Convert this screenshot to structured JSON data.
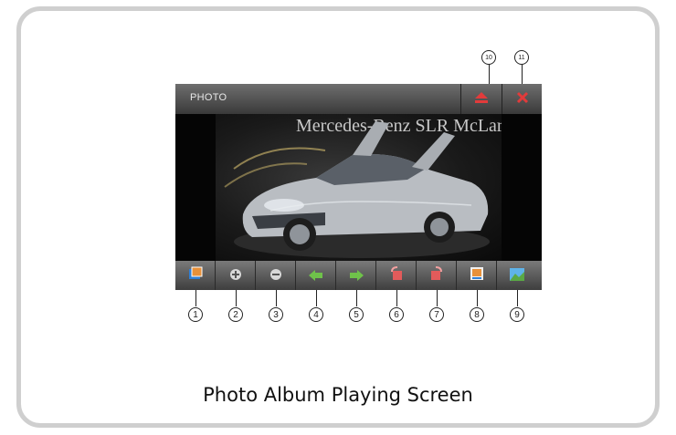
{
  "screen": {
    "title": "PHOTO",
    "photo_caption": "Mercedes-Benz SLR McLaren"
  },
  "toolbar_buttons": [
    {
      "name": "eject-button",
      "icon": "eject-icon",
      "color": "#e23b3b"
    },
    {
      "name": "close-button",
      "icon": "close-icon",
      "color": "#e23b3b"
    }
  ],
  "control_buttons": [
    {
      "name": "slideshow-button",
      "icon": "slideshow-icon"
    },
    {
      "name": "zoom-in-button",
      "icon": "zoom-in-icon"
    },
    {
      "name": "zoom-out-button",
      "icon": "zoom-out-icon"
    },
    {
      "name": "previous-button",
      "icon": "arrow-left-icon"
    },
    {
      "name": "next-button",
      "icon": "arrow-right-icon"
    },
    {
      "name": "rotate-left-button",
      "icon": "rotate-left-icon"
    },
    {
      "name": "rotate-right-button",
      "icon": "rotate-right-icon"
    },
    {
      "name": "info-button",
      "icon": "info-icon"
    },
    {
      "name": "thumbnail-button",
      "icon": "picture-icon"
    }
  ],
  "callouts": [
    "1",
    "2",
    "3",
    "4",
    "5",
    "6",
    "7",
    "8",
    "9",
    "10",
    "11"
  ],
  "caption": "Photo Album Playing Screen"
}
